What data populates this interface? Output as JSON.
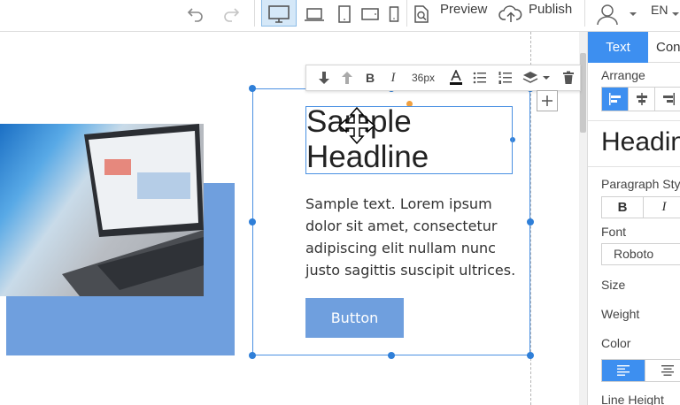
{
  "topbar": {
    "undo_icon": "undo-icon",
    "redo_icon": "redo-icon",
    "devices": [
      "desktop-icon",
      "laptop-icon",
      "tablet-icon",
      "tablet-landscape-icon",
      "phone-icon"
    ],
    "preview_label": "Preview",
    "publish_label": "Publish",
    "language": "EN"
  },
  "canvas": {
    "headline": "Sample Headline",
    "body_text": "Sample text. Lorem ipsum dolor sit amet, consectetur adipiscing elit nullam nunc justo sagittis suscipit ultrices.",
    "button_label": "Button",
    "toolbar": {
      "font_size": "36px"
    }
  },
  "panel": {
    "tabs": [
      "Text",
      "Con"
    ],
    "arrange_label": "Arrange",
    "heading_preview": "Headin",
    "paragraph_style_label": "Paragraph Sty",
    "bold_label": "B",
    "italic_label": "I",
    "font_label": "Font",
    "font_value": "Roboto",
    "size_label": "Size",
    "weight_label": "Weight",
    "color_label": "Color",
    "line_height_label": "Line Height"
  },
  "colors": {
    "accent": "#3d8ff0",
    "selection": "#4a90e2",
    "sample_blue": "#6f9fde"
  }
}
